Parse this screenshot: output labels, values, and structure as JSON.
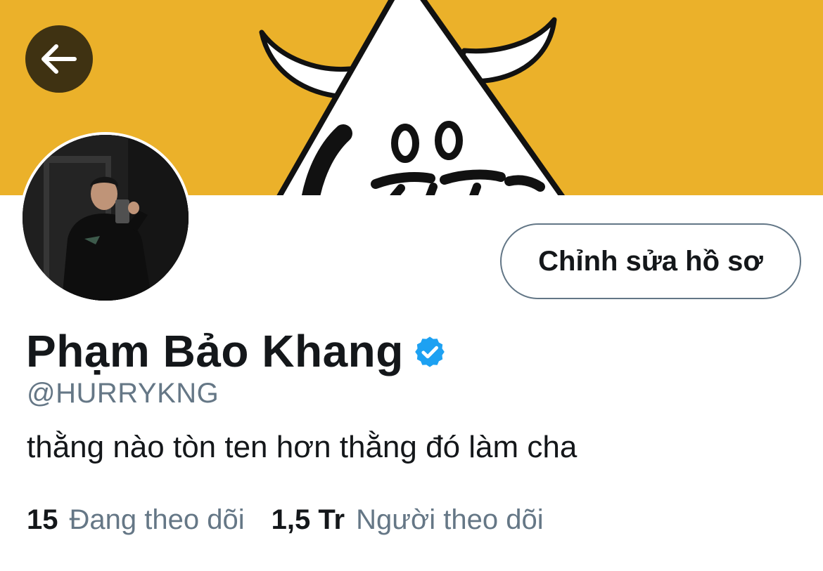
{
  "banner": {
    "background_color": "#EBB12A",
    "image": "cartoon-cow-illustration"
  },
  "header": {
    "back_icon": "arrow-left-icon"
  },
  "profile": {
    "avatar": "profile-photo",
    "edit_button_label": "Chỉnh sửa hồ sơ",
    "display_name": "Phạm Bảo Khang",
    "verified_icon": "verified-badge-icon",
    "verified_color": "#1DA1F2",
    "handle": "@HURRYKNG",
    "bio": "thằng nào tòn ten hơn thằng đó làm cha"
  },
  "stats": {
    "following": {
      "value": "15",
      "label": "Đang theo dõi"
    },
    "followers": {
      "value": "1,5 Tr",
      "label": "Người theo dõi"
    }
  },
  "colors": {
    "text_primary": "#14171a",
    "text_secondary": "#657786",
    "button_border": "#627686"
  }
}
